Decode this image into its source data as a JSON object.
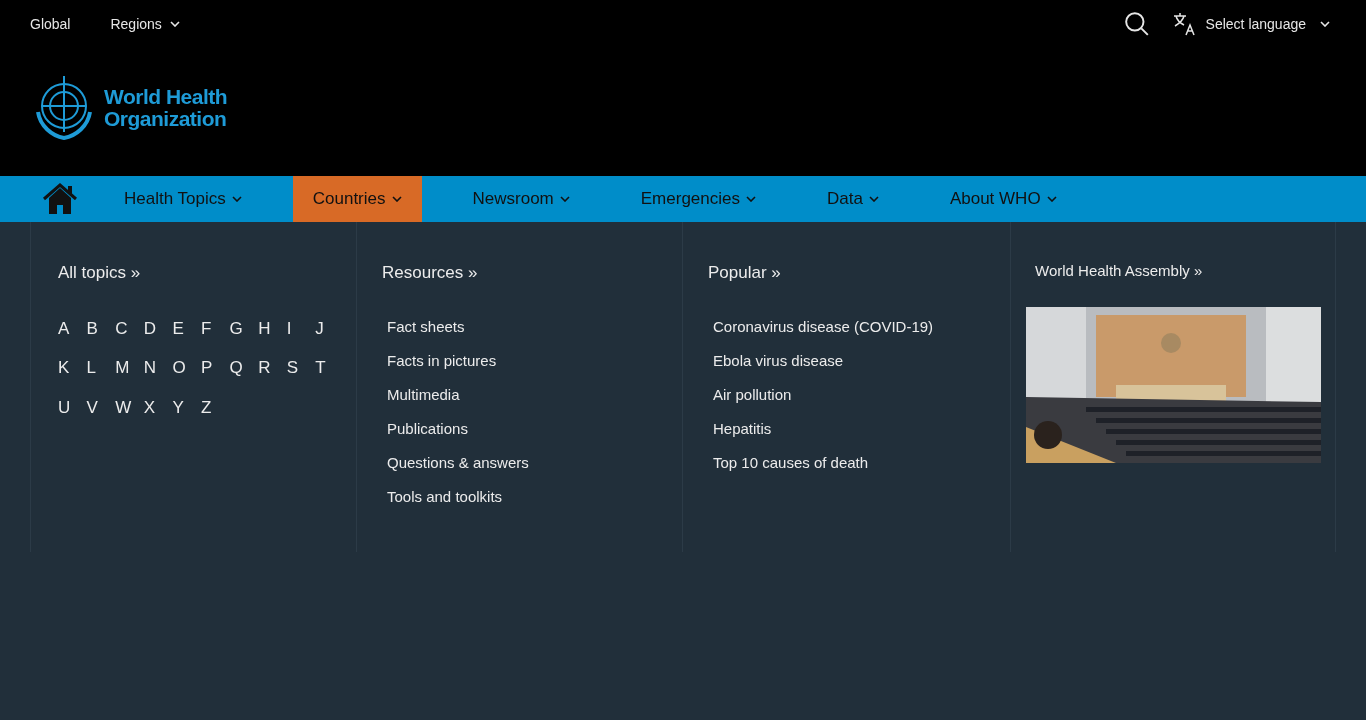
{
  "top_bar": {
    "links": [
      "Global"
    ],
    "regions": {
      "label": "Regions"
    },
    "language": {
      "label": "Select language"
    }
  },
  "logo": {
    "line_1": "World Health",
    "line_2": "Organization"
  },
  "nav": [
    {
      "label": "Health Topics",
      "selected": false
    },
    {
      "label": "Countries",
      "selected": true
    },
    {
      "label": "Newsroom",
      "selected": false
    },
    {
      "label": "Emergencies",
      "selected": false
    },
    {
      "label": "Data",
      "selected": false
    },
    {
      "label": "About WHO",
      "selected": false
    }
  ],
  "dropdown": {
    "all_topics": {
      "title": "All topics »",
      "letters": [
        "A",
        "B",
        "C",
        "D",
        "E",
        "F",
        "G",
        "H",
        "I",
        "J",
        "K",
        "L",
        "M",
        "N",
        "O",
        "P",
        "Q",
        "R",
        "S",
        "T",
        "U",
        "V",
        "W",
        "X",
        "Y",
        "Z"
      ]
    },
    "resources": {
      "title": "Resources »",
      "items": [
        "Fact sheets",
        "Facts in pictures",
        "Multimedia",
        "Publications",
        "Questions & answers",
        "Tools and toolkits"
      ]
    },
    "popular": {
      "title": "Popular »",
      "items": [
        "Coronavirus disease (COVID-19)",
        "Ebola virus disease",
        "Air pollution",
        "Hepatitis",
        "Top 10 causes of death"
      ]
    },
    "feature": {
      "title": "World Health Assembly »"
    }
  }
}
